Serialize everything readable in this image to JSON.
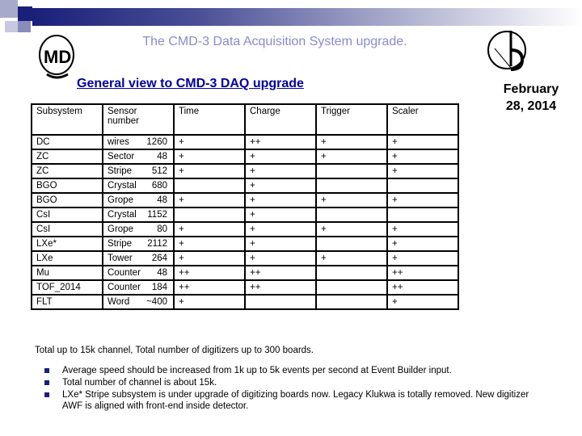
{
  "header": {
    "title": "The CMD-3 Data Acquisition System upgrade.",
    "subtitle": "General view to CMD-3 DAQ upgrade ",
    "date": "February 28, 2014",
    "logo_left": "CMD",
    "logo_right": "BINP"
  },
  "table": {
    "headers": [
      "Subsystem",
      "Sensor number",
      "Time",
      "Charge",
      "Trigger",
      "Scaler"
    ],
    "rows": [
      [
        "DC",
        "wires",
        "1260",
        "+",
        "++",
        "+",
        "+"
      ],
      [
        "ZC",
        "Sector",
        "48",
        "+",
        "+",
        "+",
        "+"
      ],
      [
        "ZC",
        "Stripe",
        "512",
        "+",
        "+",
        "",
        "+"
      ],
      [
        "BGO",
        "Crystal",
        "680",
        "",
        "+",
        "",
        ""
      ],
      [
        "BGO",
        "Grope",
        "48",
        "+",
        "+",
        "+",
        "+"
      ],
      [
        "CsI",
        "Crystal",
        "1152",
        "",
        "+",
        "",
        ""
      ],
      [
        "CsI",
        "Grope",
        "80",
        "+",
        "+",
        "+",
        "+"
      ],
      [
        "LXe*",
        "Stripe",
        "2112",
        "+",
        "+",
        "",
        "+"
      ],
      [
        "LXe",
        "Tower",
        "264",
        "+",
        "+",
        "+",
        "+"
      ],
      [
        "Mu",
        "Counter",
        "48",
        "++",
        "++",
        "",
        "++"
      ],
      [
        "TOF_2014",
        "Counter",
        "184",
        "++",
        "++",
        "",
        "++"
      ],
      [
        "FLT",
        "Word",
        "~400",
        "+",
        "",
        "",
        "+"
      ]
    ]
  },
  "note": "Total up to 15k channel, Total number of digitizers up to 300 boards.",
  "bullets": [
    "Average speed should be increased from 1k up to 5k events per second at Event Builder input.",
    "Total number of channel is about 15k.",
    " LXe* Stripe subsystem is under upgrade of digitizing boards now. Legacy Klukwa is totally removed. New digitizer AWF is aligned with front-end inside detector."
  ]
}
